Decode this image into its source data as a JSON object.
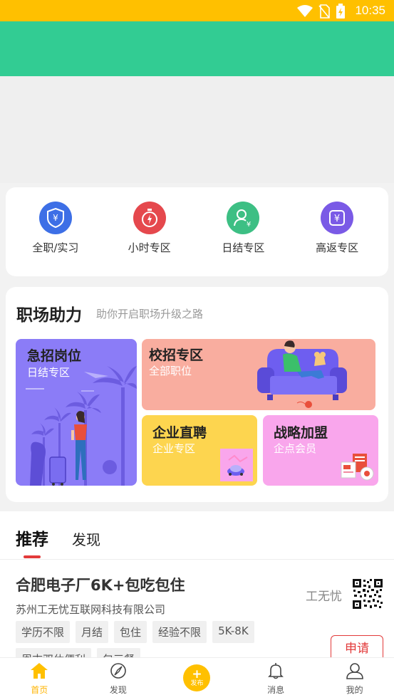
{
  "status_bar": {
    "time": "10:35"
  },
  "categories": [
    {
      "label": "全职/实习",
      "icon": "yen-shield-icon",
      "color": "#3d6fe6"
    },
    {
      "label": "小时专区",
      "icon": "stopwatch-icon",
      "color": "#e5484d"
    },
    {
      "label": "日结专区",
      "icon": "person-yen-icon",
      "color": "#3dbf84"
    },
    {
      "label": "高返专区",
      "icon": "yen-card-icon",
      "color": "#7a5ae6"
    }
  ],
  "workplace": {
    "title": "职场助力",
    "subtitle": "助你开启职场升级之路",
    "tiles": {
      "urgent": {
        "title": "急招岗位",
        "sub": "日结专区",
        "color": "#8b7cf7"
      },
      "campus": {
        "title": "校招专区",
        "sub": "全部职位",
        "color": "#f9ad9f"
      },
      "direct": {
        "title": "企业直聘",
        "sub": "企业专区",
        "color": "#fdd54f"
      },
      "alliance": {
        "title": "战略加盟",
        "sub": "企点会员",
        "color": "#f9a6ec"
      }
    }
  },
  "feed": {
    "tabs": {
      "recommend": "推荐",
      "discover": "发现"
    },
    "job": {
      "title": "合肥电子厂6K+包吃包住",
      "company": "苏州工无忧互联网科技有限公司",
      "tags": [
        "学历不限",
        "月结",
        "包住",
        "经验不限",
        "5K-8K"
      ],
      "tags2": [
        "周末双休便利",
        "包三餐"
      ],
      "brand": "工无忧",
      "apply": "申请"
    }
  },
  "bottom_nav": {
    "home": "首页",
    "discover": "发现",
    "publish": "发布",
    "messages": "消息",
    "mine": "我的"
  },
  "colors": {
    "status_bar": "#ffc000",
    "header": "#32cc93",
    "accent_red": "#e23a3a",
    "nav_active": "#ffb400"
  }
}
